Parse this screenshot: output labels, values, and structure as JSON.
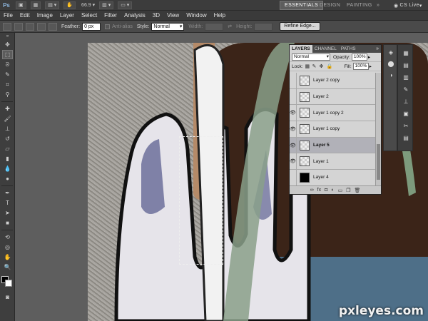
{
  "appbar": {
    "logo": "Ps",
    "zoom": "66.9",
    "workspaces": [
      "ESSENTIALS",
      "DESIGN",
      "PAINTING"
    ],
    "cs_live": "CS Live"
  },
  "menu": [
    "File",
    "Edit",
    "Image",
    "Layer",
    "Select",
    "Filter",
    "Analysis",
    "3D",
    "View",
    "Window",
    "Help"
  ],
  "options": {
    "feather_label": "Feather:",
    "feather_value": "0 px",
    "antialias_label": "Anti-alias",
    "style_label": "Style:",
    "style_value": "Normal",
    "width_label": "Width:",
    "height_label": "Height:",
    "refine_label": "Refine Edge..."
  },
  "layers_panel": {
    "tabs": [
      "LAYERS",
      "CHANNEL",
      "PATHS"
    ],
    "menu_glyph": "»",
    "blend_mode": "Normal",
    "opacity_label": "Opacity:",
    "opacity_value": "100%",
    "lock_label": "Lock:",
    "fill_label": "Fill:",
    "fill_value": "100%",
    "layers": [
      {
        "name": "Layer 2 copy",
        "visible": false,
        "selected": false,
        "thumb": "transparent"
      },
      {
        "name": "Layer 2",
        "visible": false,
        "selected": false,
        "thumb": "transparent"
      },
      {
        "name": "Layer 1 copy 2",
        "visible": true,
        "selected": false,
        "thumb": "transparent"
      },
      {
        "name": "Layer 1 copy",
        "visible": true,
        "selected": false,
        "thumb": "transparent"
      },
      {
        "name": "Layer 5",
        "visible": true,
        "selected": true,
        "thumb": "transparent"
      },
      {
        "name": "Layer 1",
        "visible": true,
        "selected": false,
        "thumb": "transparent"
      },
      {
        "name": "Layer 4",
        "visible": false,
        "selected": false,
        "thumb": "black"
      }
    ]
  },
  "watermark": "pxleyes.com"
}
